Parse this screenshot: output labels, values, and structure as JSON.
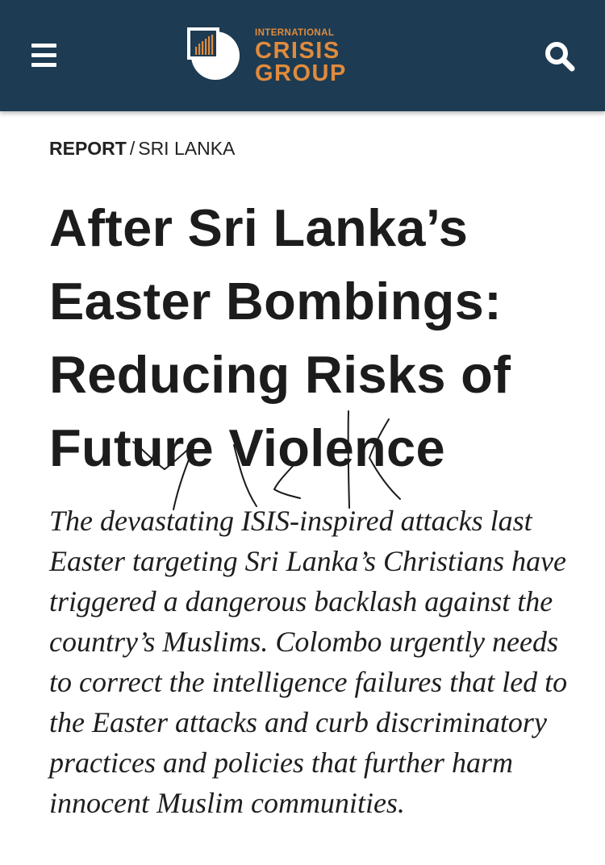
{
  "header": {
    "menu_icon": "hamburger-menu-icon",
    "logo": {
      "line1": "INTERNATIONAL",
      "line2": "CRISIS",
      "line3": "GROUP",
      "icon": "crisis-group-logo-icon"
    },
    "search_icon": "search-icon",
    "background_color": "#1d3b52",
    "accent_color": "#e08b3d"
  },
  "breadcrumb": {
    "type": "REPORT",
    "separator": "/",
    "country": "SRI LANKA"
  },
  "article": {
    "title": "After Sri Lanka’s Easter Bombings: Reducing Risks of Future Violence",
    "summary": "The devastating ISIS-inspired attacks last Easter targeting Sri Lanka’s Christians have triggered a dangerous backlash against the country’s Muslims. Colombo urgently needs to correct the intelligence failures that led to the Easter attacks and curb discriminatory practices and policies that further harm innocent Muslim communities."
  },
  "annotation": {
    "type": "handwritten-scribble-icon"
  }
}
